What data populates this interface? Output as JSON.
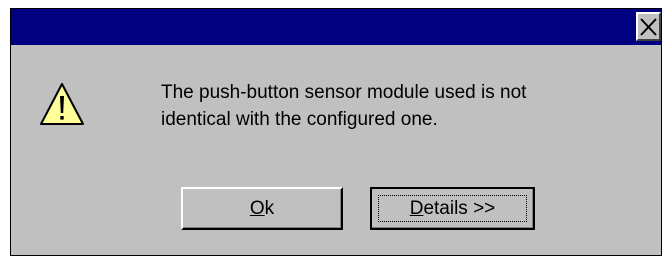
{
  "dialog": {
    "title": "",
    "message": "The push-button sensor module used is not\nidentical with the configured one.",
    "icon": "warning-icon"
  },
  "buttons": {
    "ok_label": "Ok",
    "details_label": "Details >>"
  },
  "colors": {
    "titlebar": "#000080",
    "face": "#c0c0c0",
    "warning_fill": "#ffff99"
  }
}
